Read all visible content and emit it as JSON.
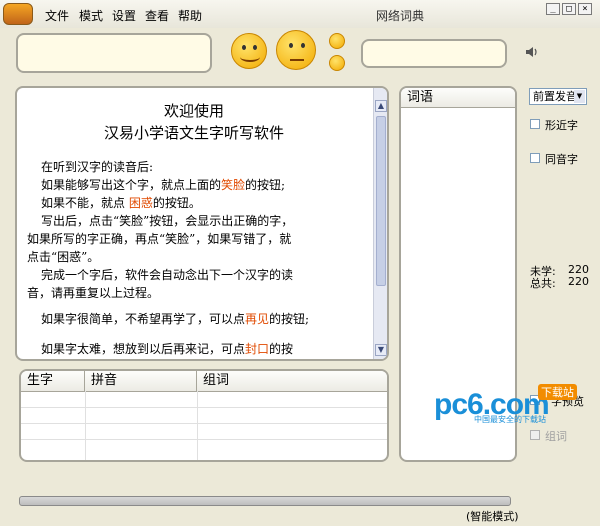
{
  "menu": {
    "items": [
      "文件",
      "模式",
      "设置",
      "查看",
      "帮助"
    ]
  },
  "window": {
    "title": "网络词典",
    "controls": [
      "_",
      "□",
      "×"
    ]
  },
  "intro": {
    "title_line1": "欢迎使用",
    "title_line2": "汉易小学语文生字听写软件",
    "p1": "在听到汉字的读音后:",
    "p2_a": "如果能够写出这个字，就点上面的",
    "p2_hl": "笑脸",
    "p2_b": "的按钮;",
    "p3_a": "如果不能，就点 ",
    "p3_hl": "困惑",
    "p3_b": "的按钮。",
    "p4": "写出后，点击“笑脸”按钮，会显示出正确的字，",
    "p5": "如果所写的字正确，再点“笑脸”，如果写错了，就",
    "p6": "点击“困惑”。",
    "p7": "完成一个字后，软件会自动念出下一个汉字的读",
    "p8": "音，请再重复以上过程。",
    "p9_a": "如果字很简单，不希望再学了，可以点",
    "p9_hl": "再见",
    "p9_b": "的按钮;",
    "p10_a": "如果字太难，想放到以后再来记，可点",
    "p10_hl": "封口",
    "p10_b": "的按"
  },
  "word_list": {
    "header": "词语"
  },
  "pronunciation_select": {
    "value": "前置发音"
  },
  "options": {
    "similar_shape": "形近字",
    "same_sound": "同音字",
    "preview": "字预览",
    "group_words": "组词"
  },
  "stats": {
    "unlearned_label": "未学:",
    "unlearned_value": "220",
    "total_label": "总共:",
    "total_value": "220"
  },
  "table": {
    "columns": [
      "生字",
      "拼音",
      "组词"
    ]
  },
  "status": {
    "mode": "(智能模式)"
  },
  "watermark": {
    "brand": "pc6.com",
    "badge": "下载站",
    "tagline": "中国最安全的下载站"
  },
  "colors": {
    "highlight": "#e04a00",
    "watermark_blue": "#1a8fd8",
    "watermark_orange": "#f28c00"
  },
  "icons": [
    "speaker-icon",
    "grin-face-icon",
    "confused-face-icon",
    "small-smile-icon",
    "small-sad-icon"
  ]
}
